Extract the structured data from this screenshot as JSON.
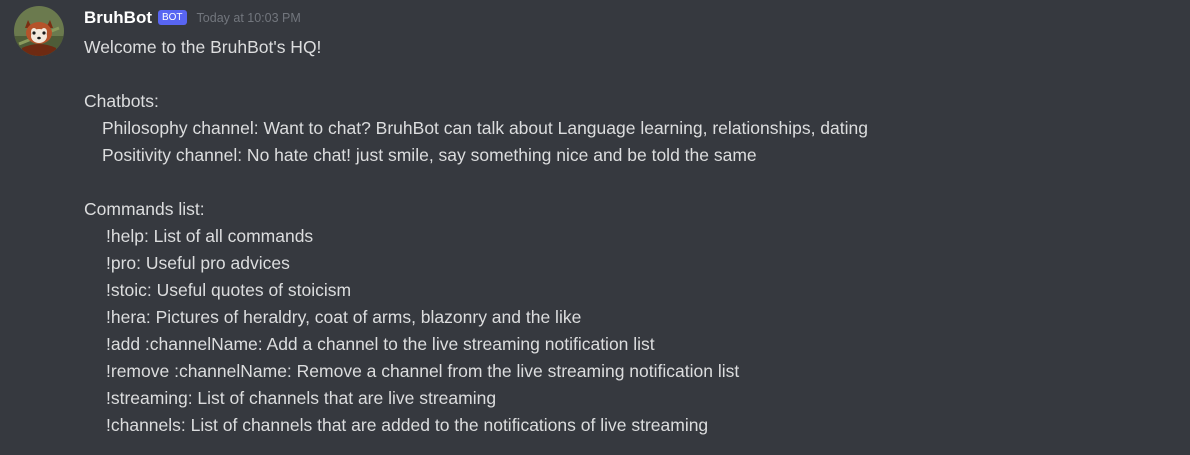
{
  "message": {
    "author": "BruhBot",
    "bot_tag": "BOT",
    "timestamp": "Today at 10:03 PM",
    "avatar": "red-panda-avatar",
    "lines": [
      "Welcome to the BruhBot's HQ!",
      "",
      "Chatbots:",
      "Philosophy channel: Want to chat? BruhBot can talk about Language learning, relationships, dating",
      "Positivity channel: No hate chat! just smile, say something nice and be told the same",
      "",
      "Commands list:",
      "!help: List of all commands",
      "!pro: Useful pro advices",
      "!stoic: Useful quotes of stoicism",
      "!hera: Pictures of heraldry, coat of arms, blazonry and the like",
      "!add :channelName: Add a channel to the live streaming notification list",
      "!remove :channelName: Remove a channel from the live streaming notification list",
      "!streaming: List of channels that are live streaming",
      "!channels: List of channels that are added to the notifications of live streaming"
    ]
  },
  "colors": {
    "background": "#36393f",
    "username": "#ffffff",
    "bot_tag": "#5865f2",
    "timestamp": "#72767d",
    "text": "#dcddde"
  }
}
